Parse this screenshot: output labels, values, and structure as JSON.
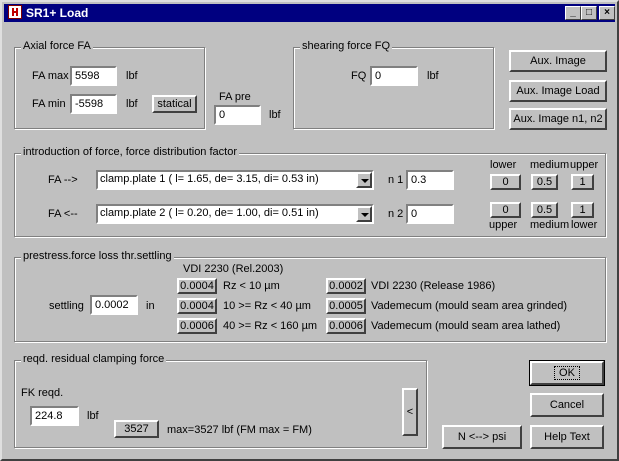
{
  "window": {
    "title": "SR1+ Load",
    "minimize": "_",
    "maximize": "□",
    "close": "×"
  },
  "axial": {
    "title": "Axial force FA",
    "fa_max_label": "FA max",
    "fa_max_value": "5598",
    "fa_max_unit": "lbf",
    "fa_min_label": "FA min",
    "fa_min_value": "-5598",
    "fa_min_unit": "lbf",
    "statical_button": "statical"
  },
  "fa_pre": {
    "label": "FA pre",
    "value": "0",
    "unit": "lbf"
  },
  "shearing": {
    "title": "shearing force FQ",
    "fq_label": "FQ",
    "fq_value": "0",
    "fq_unit": "lbf"
  },
  "aux_buttons": {
    "image": "Aux. Image",
    "image_load": "Aux. Image Load",
    "image_n1n2": "Aux. Image n1, n2"
  },
  "introduction": {
    "title": "introduction of force, force distribution factor",
    "row1": {
      "label": "FA  -->",
      "selected": "clamp.plate 1  ( l= 1.65, de= 3.15, di= 0.53 in)",
      "n_label": "n 1",
      "n_value": "0.3"
    },
    "row2": {
      "label": "FA  <--",
      "selected": "clamp.plate 2  ( l= 0.20, de= 1.00, di= 0.51 in)",
      "n_label": "n 2",
      "n_value": "0"
    },
    "top_labels": {
      "lower": "lower",
      "medium": "medium",
      "upper": "upper"
    },
    "bottom_labels": {
      "upper": "upper",
      "medium": "medium",
      "lower": "lower"
    },
    "top_buttons": [
      "0",
      "0.5",
      "1"
    ],
    "bottom_buttons": [
      "0",
      "0.5",
      "1"
    ]
  },
  "prestress": {
    "title": "prestress.force loss thr.settling",
    "vdi_header": "VDI 2230 (Rel.2003)",
    "settling_label": "settling",
    "settling_value": "0.0002",
    "settling_unit": "in",
    "left_rows": [
      {
        "button": "0.0004",
        "label": "Rz < 10 µm"
      },
      {
        "button": "0.0004",
        "label": "10 >= Rz < 40 µm"
      },
      {
        "button": "0.0006",
        "label": "40 >= Rz < 160 µm"
      }
    ],
    "right_rows": [
      {
        "button": "0.0002",
        "label": "VDI 2230 (Release 1986)"
      },
      {
        "button": "0.0005",
        "label": "Vademecum (mould seam area grinded)"
      },
      {
        "button": "0.0006",
        "label": "Vademecum (mould seam area lathed)"
      }
    ]
  },
  "residual": {
    "title": "reqd. residual clamping force",
    "fk_label": "FK reqd.",
    "fk_value": "224.8",
    "fk_unit": "lbf",
    "fm_button": "3527",
    "fm_text": "max=3527 lbf  (FM max = FM)",
    "arrow_button": "<"
  },
  "bottom_buttons": {
    "ok": "OK",
    "cancel": "Cancel",
    "help": "Help Text",
    "units": "N <--> psi"
  }
}
